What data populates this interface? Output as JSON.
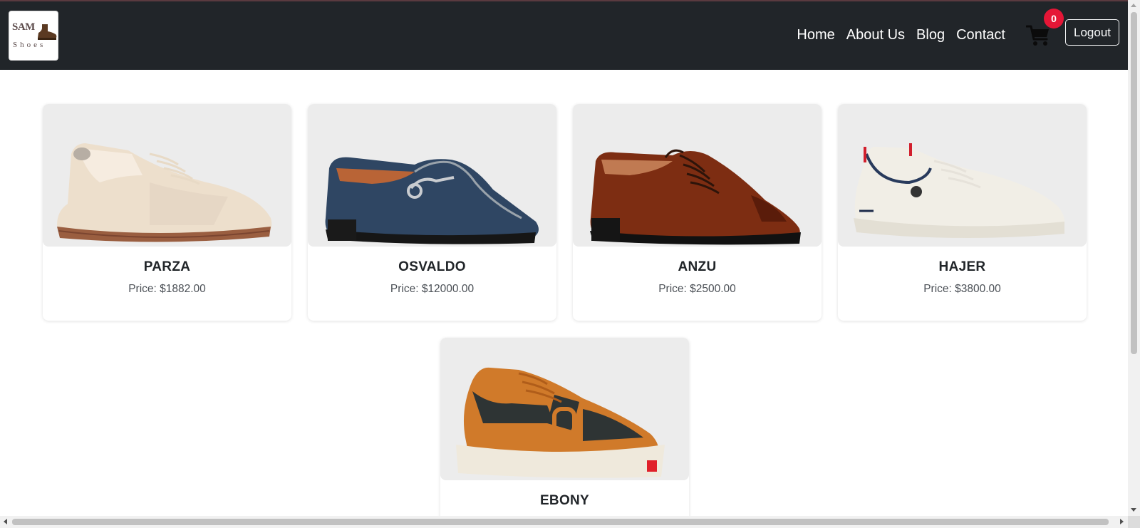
{
  "brand": {
    "logo_top": "SAM",
    "logo_bottom": "Shoes"
  },
  "nav": {
    "links": [
      "Home",
      "About Us",
      "Blog",
      "Contact"
    ],
    "cart_count": "0",
    "logout_label": "Logout"
  },
  "products": [
    {
      "name": "PARZA",
      "price": "Price: $1882.00",
      "image": "beige-sneaker"
    },
    {
      "name": "OSVALDO",
      "price": "Price: $12000.00",
      "image": "navy-suede-loafer"
    },
    {
      "name": "ANZU",
      "price": "Price: $2500.00",
      "image": "brown-oxford-shoe"
    },
    {
      "name": "HAJER",
      "price": "Price: $3800.00",
      "image": "white-sneaker"
    },
    {
      "name": "EBONY",
      "price": "",
      "image": "orange-black-sneaker"
    }
  ],
  "colors": {
    "navbar": "#212529",
    "badge": "#e51636",
    "card_image_bg": "#ececec"
  }
}
